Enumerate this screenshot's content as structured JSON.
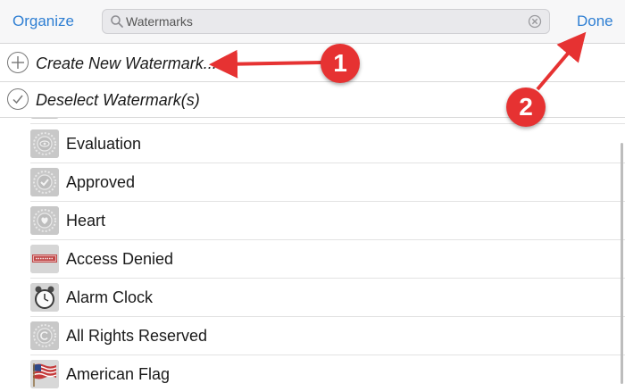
{
  "toolbar": {
    "organize_label": "Organize",
    "search_value": "Watermarks",
    "done_label": "Done"
  },
  "actions": {
    "create_label": "Create New Watermark...",
    "deselect_label": "Deselect Watermark(s)"
  },
  "watermarks": [
    {
      "name": "Evaluation",
      "icon": "seal-eye-icon"
    },
    {
      "name": "Approved",
      "icon": "seal-check-icon"
    },
    {
      "name": "Heart",
      "icon": "seal-heart-icon"
    },
    {
      "name": "Access Denied",
      "icon": "stamp-icon"
    },
    {
      "name": "Alarm Clock",
      "icon": "alarm-clock-icon"
    },
    {
      "name": "All Rights Reserved",
      "icon": "seal-copyright-icon"
    },
    {
      "name": "American Flag",
      "icon": "flag-icon"
    }
  ],
  "annotations": {
    "badge1": "1",
    "badge2": "2",
    "color": "#e63232"
  },
  "colors": {
    "accent": "#2f7fd3",
    "annotation": "#e63232"
  }
}
